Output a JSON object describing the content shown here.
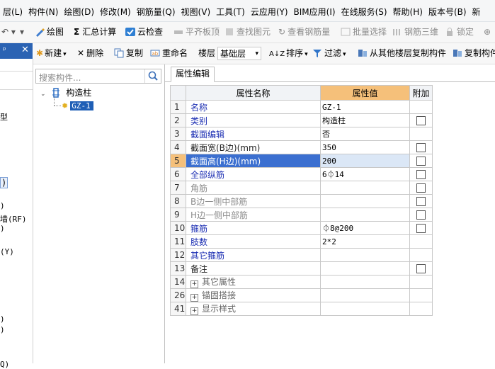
{
  "menu": [
    "层(L)",
    "构件(N)",
    "绘图(D)",
    "修改(M)",
    "钢筋量(Q)",
    "视图(V)",
    "工具(T)",
    "云应用(Y)",
    "BIM应用(I)",
    "在线服务(S)",
    "帮助(H)",
    "版本号(B)",
    "新"
  ],
  "toolbar1": {
    "draw": "绘图",
    "sum": "汇总计算",
    "cloud_check": "云检查",
    "level_slab": "平齐板顶",
    "find": "查找图元",
    "view_rebar": "查看钢筋量",
    "batch_select": "批量选择",
    "rebar_3d": "钢筋三维",
    "lock": "锁定"
  },
  "toolbar2": {
    "new": "新建",
    "delete": "删除",
    "copy": "复制",
    "rename": "重命名",
    "floor_label": "楼层",
    "floor_value": "基础层",
    "sort": "排序",
    "filter": "过滤",
    "copy_from_other": "从其他楼层复制构件",
    "copy_to_other": "复制构件"
  },
  "left_panel_fragments": [
    "型",
    ")",
    ")",
    "墙(RF)",
    ")",
    "(Y)",
    ")",
    ")",
    "Q)"
  ],
  "search": {
    "placeholder": "搜索构件..."
  },
  "tree": {
    "root": "构造柱",
    "child": "GZ-1"
  },
  "tab": "属性编辑",
  "table": {
    "headers": {
      "name": "属性名称",
      "value": "属性值",
      "extra": "附加"
    },
    "rows": [
      {
        "num": "1",
        "name": "名称",
        "value": "GZ-1",
        "style": "blue",
        "checkbox": false
      },
      {
        "num": "2",
        "name": "类别",
        "value": "构造柱",
        "style": "blue",
        "checkbox": true
      },
      {
        "num": "3",
        "name": "截面编辑",
        "value": "否",
        "style": "blue",
        "checkbox": false
      },
      {
        "num": "4",
        "name": "截面宽(B边)(mm)",
        "value": "350",
        "style": "black",
        "checkbox": true
      },
      {
        "num": "5",
        "name": "截面高(H边)(mm)",
        "value": "200",
        "style": "blue",
        "checkbox": true,
        "highlight": true
      },
      {
        "num": "6",
        "name": "全部纵筋",
        "value": "6⏀14",
        "style": "blue",
        "checkbox": true
      },
      {
        "num": "7",
        "name": "角筋",
        "value": "",
        "style": "gray",
        "checkbox": true
      },
      {
        "num": "8",
        "name": "B边一侧中部筋",
        "value": "",
        "style": "gray",
        "checkbox": true
      },
      {
        "num": "9",
        "name": "H边一侧中部筋",
        "value": "",
        "style": "gray",
        "checkbox": true
      },
      {
        "num": "10",
        "name": "箍筋",
        "value": "⏀8@200",
        "style": "blue",
        "checkbox": true
      },
      {
        "num": "11",
        "name": "肢数",
        "value": "2*2",
        "style": "blue",
        "checkbox": false
      },
      {
        "num": "12",
        "name": "其它箍筋",
        "value": "",
        "style": "blue",
        "checkbox": false
      },
      {
        "num": "13",
        "name": "备注",
        "value": "",
        "style": "black",
        "checkbox": true
      },
      {
        "num": "14",
        "name": "其它属性",
        "value": "",
        "style": "group",
        "checkbox": false,
        "expandable": true
      },
      {
        "num": "26",
        "name": "锚固搭接",
        "value": "",
        "style": "group",
        "checkbox": false,
        "expandable": true
      },
      {
        "num": "41",
        "name": "显示样式",
        "value": "",
        "style": "group",
        "checkbox": false,
        "expandable": true
      }
    ]
  },
  "colors": {
    "value_header": "#f5c07a",
    "selection_blue": "#1f5fb6",
    "row_highlight": "#3b6fd0",
    "name_blue": "#1c2fb3"
  }
}
